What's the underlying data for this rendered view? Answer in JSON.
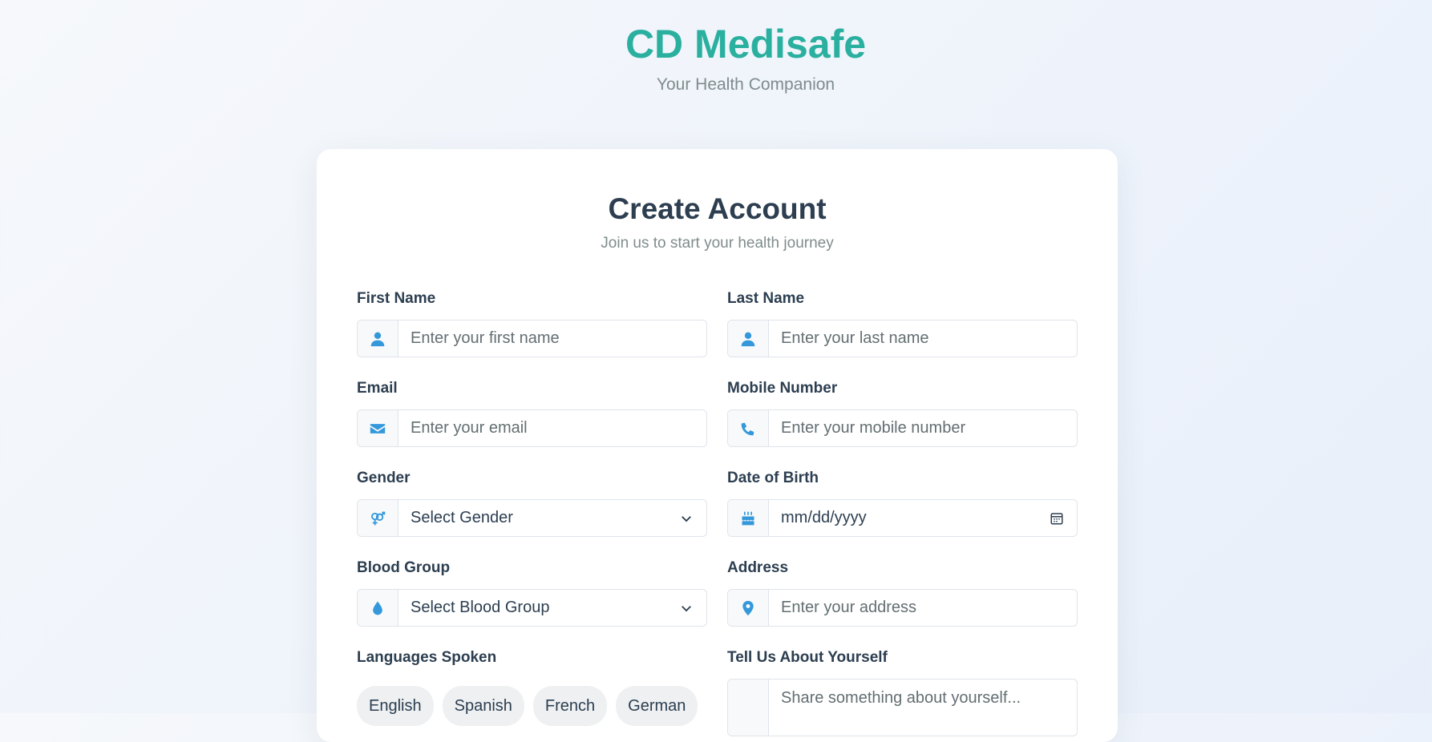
{
  "brand": {
    "title": "CD Medisafe",
    "subtitle": "Your Health Companion"
  },
  "form": {
    "title": "Create Account",
    "subtitle": "Join us to start your health journey",
    "first_name": {
      "label": "First Name",
      "placeholder": "Enter your first name",
      "icon": "user-icon"
    },
    "last_name": {
      "label": "Last Name",
      "placeholder": "Enter your last name",
      "icon": "user-icon"
    },
    "email": {
      "label": "Email",
      "placeholder": "Enter your email",
      "icon": "envelope-icon"
    },
    "mobile": {
      "label": "Mobile Number",
      "placeholder": "Enter your mobile number",
      "icon": "phone-icon"
    },
    "gender": {
      "label": "Gender",
      "selected": "Select Gender",
      "icon": "gender-icon"
    },
    "dob": {
      "label": "Date of Birth",
      "placeholder": "mm/dd/yyyy",
      "icon": "birthday-cake-icon"
    },
    "blood_group": {
      "label": "Blood Group",
      "selected": "Select Blood Group",
      "icon": "blood-drop-icon"
    },
    "address": {
      "label": "Address",
      "placeholder": "Enter your address",
      "icon": "map-pin-icon"
    },
    "languages": {
      "label": "Languages Spoken",
      "options": [
        "English",
        "Spanish",
        "French",
        "German"
      ]
    },
    "about": {
      "label": "Tell Us About Yourself",
      "placeholder": "Share something about yourself..."
    }
  },
  "colors": {
    "accent": "#3498db",
    "brand": "#2bb0a0",
    "text": "#2c3e50",
    "muted": "#7f8c8d"
  }
}
